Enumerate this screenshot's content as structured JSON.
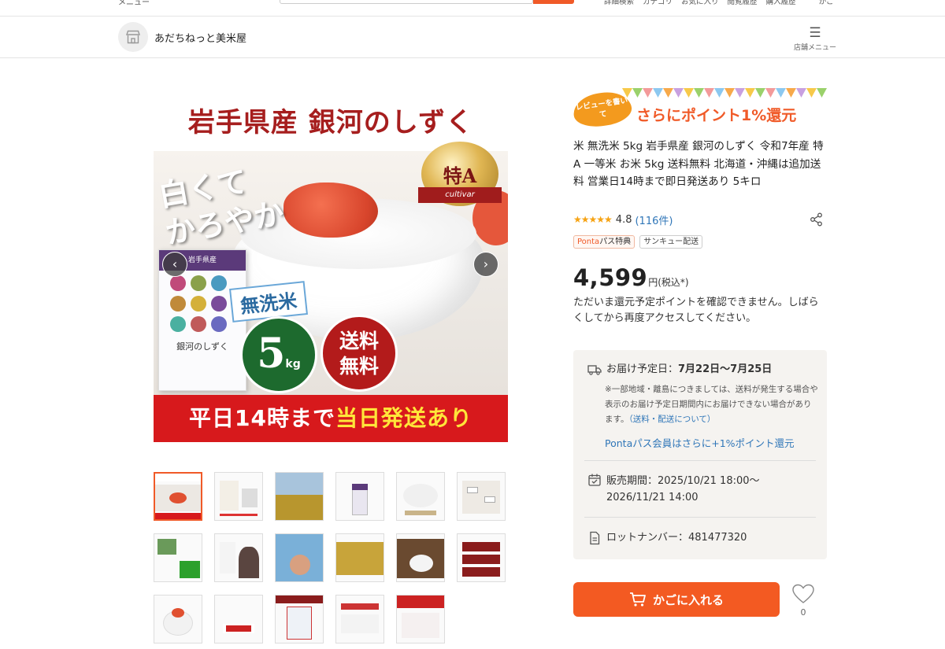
{
  "topbar": {
    "menu_label": "メニュー",
    "links": [
      "詳細検索",
      "カテゴリ",
      "お気に入り",
      "閲覧履歴",
      "購入履歴",
      "かご"
    ]
  },
  "shop": {
    "name": "あだちねっと美米屋",
    "menu_label": "店舗メニュー"
  },
  "main_image": {
    "title": "岩手県産 銀河のしずく",
    "catch": "白くて\nかろやか",
    "badge": "特A",
    "badge_ribbon": "cultivar",
    "package_top": "岩手県産",
    "package_name": "銀河のしずく",
    "musenmai": "無洗米",
    "weight_number": "5",
    "weight_unit": "kg",
    "shipping_line1": "送料",
    "shipping_line2": "無料",
    "banner_pre": "平日14時まで",
    "banner_highlight": "当日発送あり"
  },
  "review_banner": {
    "bubble": "レビューを書いて",
    "text": "さらにポイント1%還元"
  },
  "product": {
    "title": "米 無洗米 5kg 岩手県産 銀河のしずく 令和7年産 特A 一等米 お米 5kg 送料無料 北海道・沖縄は追加送料 営業日14時まで即日発送あり 5キロ",
    "rating_stars": "★★★★★",
    "rating_score": "4.8",
    "review_count": "(116件)",
    "tags": [
      {
        "main": "Ponta",
        "sub": "パス特典"
      },
      {
        "main": "サンキュー配送",
        "sub": ""
      }
    ],
    "price": "4,599",
    "price_unit": "円(税込*)",
    "point_message": "ただいま還元予定ポイントを確認できません。しばらくしてから再度アクセスしてください。"
  },
  "delivery": {
    "label": "お届け予定日：",
    "date": "7月22日〜7月25日",
    "note": "※一部地域・離島につきましては、送料が発生する場合や表示のお届け予定日期間内にお届けできない場合があります。",
    "note_link": "（送料・配送について）",
    "ponta_link": "Pontaパス会員はさらに+1%ポイント還元",
    "sale_period_line1": "販売期間：2025/10/21 18:00〜",
    "sale_period_line2": "2026/11/21 14:00",
    "lot_number": "ロットナンバー：481477320"
  },
  "actions": {
    "cart_label": "かごに入れる",
    "favorite_count": "0"
  },
  "colors": {
    "accent": "#f35a22",
    "link": "#2f76b8",
    "star": "#f6a314"
  }
}
